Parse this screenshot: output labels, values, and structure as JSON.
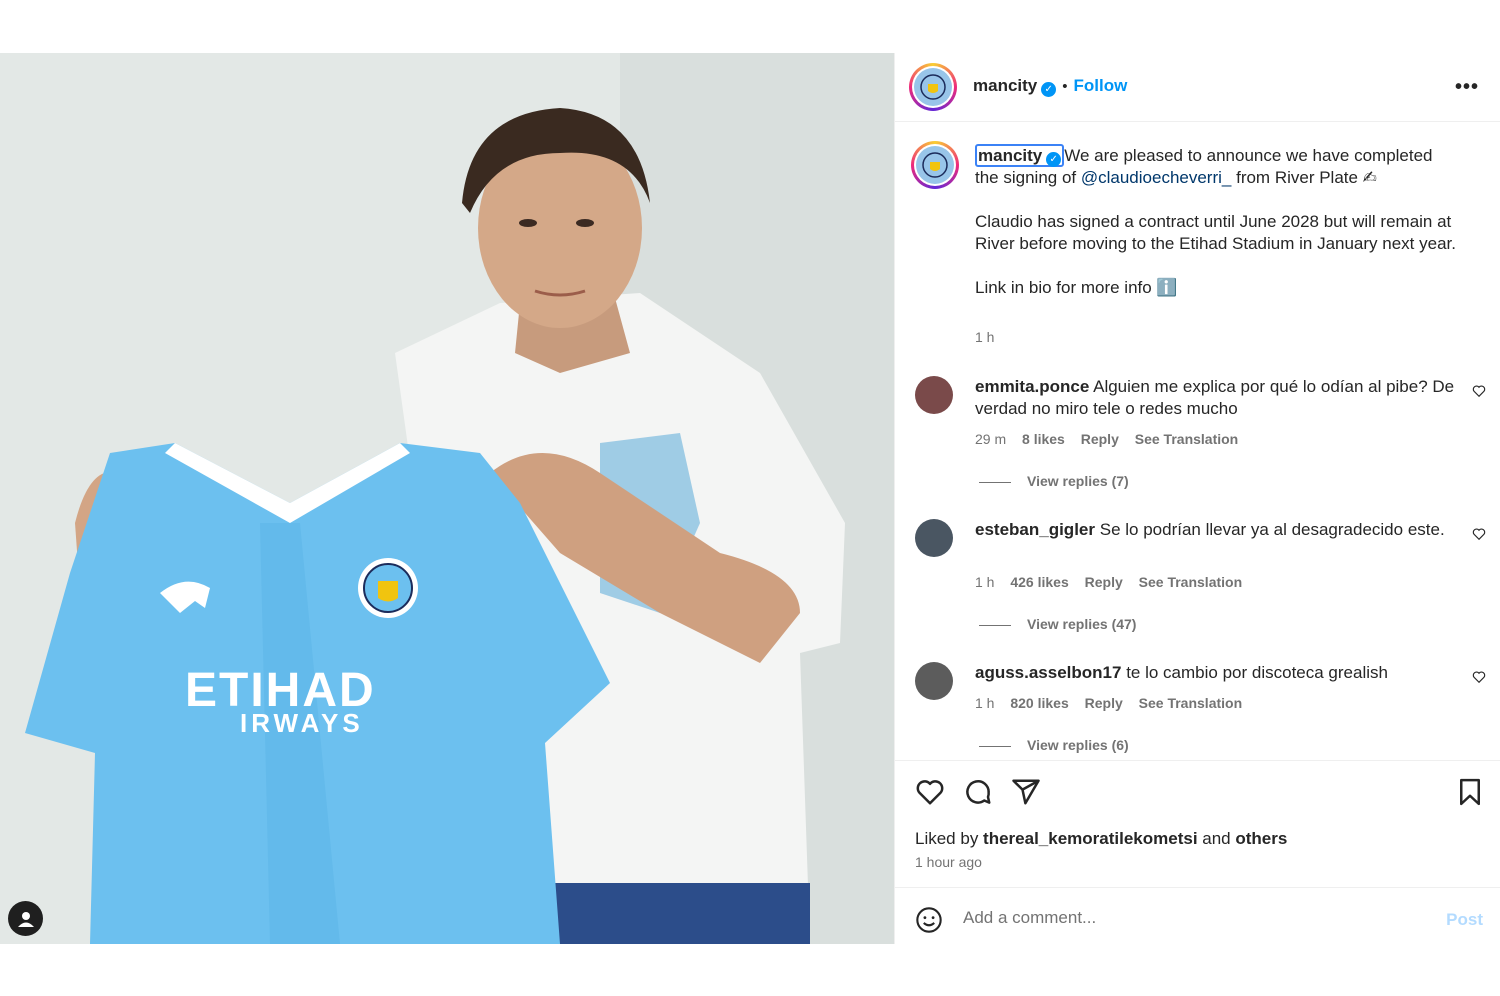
{
  "post": {
    "username": "mancity",
    "follow_label": "Follow",
    "more_icon": "more-horizontal-icon",
    "verified_icon": "verified-badge-icon"
  },
  "caption": {
    "username": "mancity",
    "line1": "We are pleased to announce we have completed",
    "line2_prefix": "the signing of ",
    "mention": "@claudioecheverri_",
    "line2_suffix": " from River Plate ✍",
    "paragraph2": "Claudio has signed a contract until June 2028 but will remain at River before moving to the Etihad Stadium in January next year.",
    "paragraph3": "Link in bio for more info ℹ️",
    "time": "1 h"
  },
  "comments": [
    {
      "user": "emmita.ponce",
      "text": "Alguien me explica por qué lo odían al pibe? De verdad no miro tele o redes mucho",
      "time": "29 m",
      "likes": "8 likes",
      "reply": "Reply",
      "translate": "See Translation",
      "replies": "View replies (7)"
    },
    {
      "user": "esteban_gigler",
      "text": "Se lo podrían llevar ya al desagradecido este.",
      "time": "1 h",
      "likes": "426 likes",
      "reply": "Reply",
      "translate": "See Translation",
      "replies": "View replies (47)"
    },
    {
      "user": "aguss.asselbon17",
      "text": "te lo cambio por discoteca grealish",
      "time": "1 h",
      "likes": "820 likes",
      "reply": "Reply",
      "translate": "See Translation",
      "replies": "View replies (6)"
    }
  ],
  "footer": {
    "liked_prefix": "Liked by ",
    "liked_user": "thereal_kemoratilekometsi",
    "liked_mid": " and ",
    "liked_others": "others",
    "time": "1 hour ago",
    "comment_placeholder": "Add a comment...",
    "post_label": "Post"
  },
  "photo": {
    "shirt_sponsor_line1": "ETIHAD",
    "shirt_sponsor_line2": "IRWAYS"
  },
  "colors": {
    "accent": "#0095f6",
    "sky_blue": "#6cc0ef",
    "mention": "#00376b"
  }
}
